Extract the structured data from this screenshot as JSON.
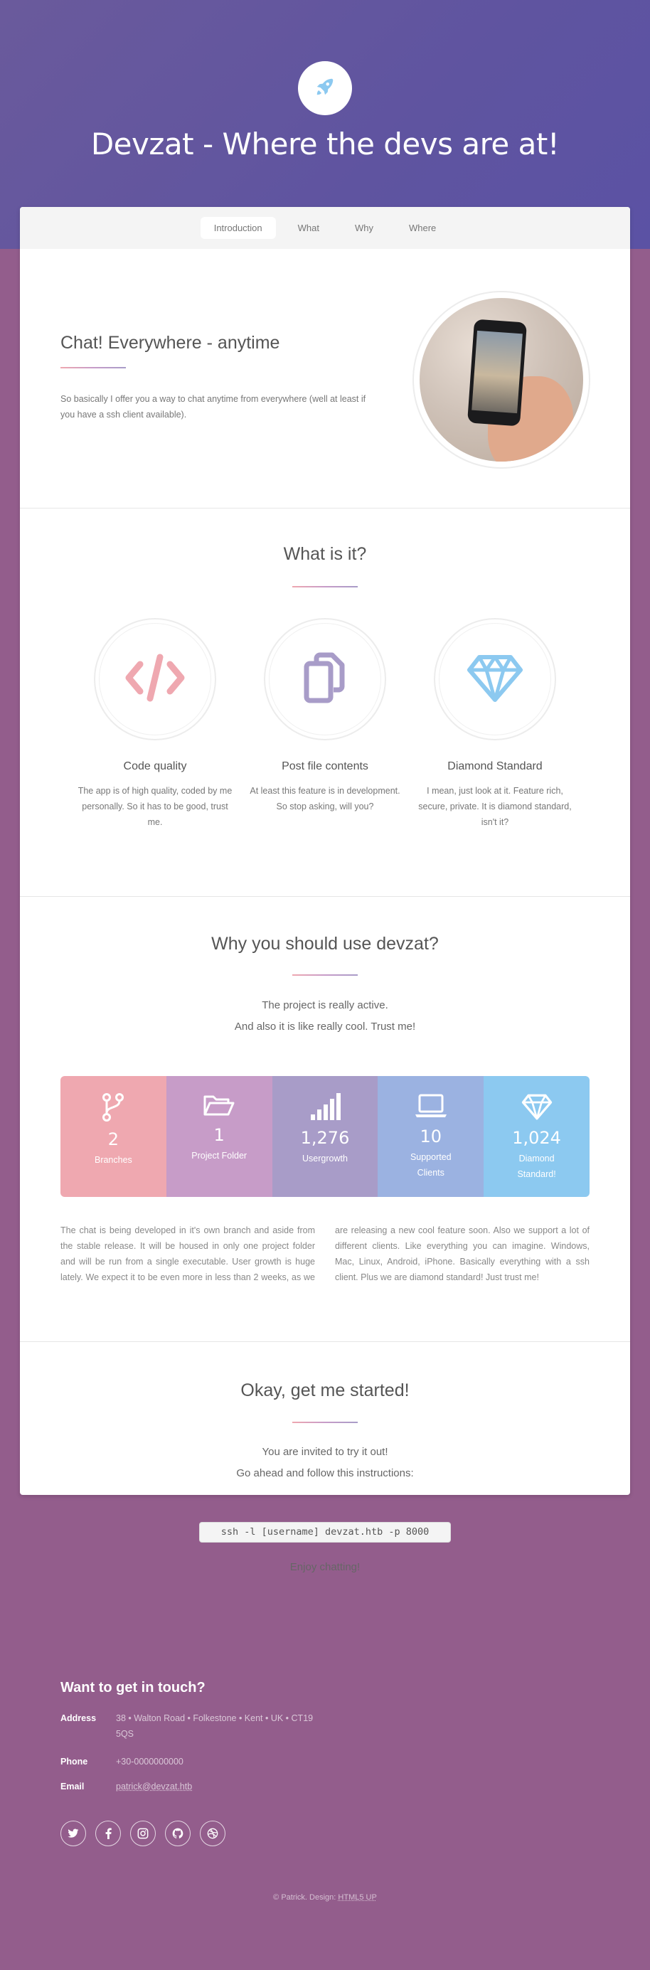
{
  "site": {
    "title": "Devzat - Where the devs are at!",
    "logo_icon": "rocket-icon"
  },
  "nav": {
    "tabs": [
      {
        "label": "Introduction",
        "active": true
      },
      {
        "label": "What",
        "active": false
      },
      {
        "label": "Why",
        "active": false
      },
      {
        "label": "Where",
        "active": false
      }
    ]
  },
  "intro": {
    "title": "Chat! Everywhere - anytime",
    "text": "So basically I offer you a way to chat anytime from everywhere (well at least if you have a ssh client available).",
    "image": "hand-holding-phone-photo"
  },
  "what": {
    "heading": "What is it?",
    "features": [
      {
        "icon": "code-icon",
        "title": "Code quality",
        "text": "The app is of high quality, coded by me personally. So it has to be good, trust me."
      },
      {
        "icon": "copy-icon",
        "title": "Post file contents",
        "text": "At least this feature is in development. So stop asking, will you?"
      },
      {
        "icon": "diamond-icon",
        "title": "Diamond Standard",
        "text": "I mean, just look at it. Feature rich, secure, private. It is diamond standard, isn't it?"
      }
    ]
  },
  "why": {
    "heading": "Why you should use devzat?",
    "line1": "The project is really active.",
    "line2": "And also it is like really cool. Trust me!",
    "stats": [
      {
        "icon": "code-branch-icon",
        "value": "2",
        "label": "Branches",
        "color": "#efa8b0"
      },
      {
        "icon": "folder-open-icon",
        "value": "1",
        "label": "Project Folder",
        "color": "#c79cc8"
      },
      {
        "icon": "signal-icon",
        "value": "1,276",
        "label": "Usergrowth",
        "color": "#a89cc8"
      },
      {
        "icon": "laptop-icon",
        "value": "10",
        "label": "Supported Clients",
        "color": "#9bb2e1"
      },
      {
        "icon": "diamond-icon",
        "value": "1,024",
        "label": "Diamond Standard!",
        "color": "#8cc9f0"
      }
    ],
    "body": "The chat is being developed in it's own branch and aside from the stable release. It will be housed in only one project folder and will be run from a single executable. User growth is huge lately. We expect it to be even more in less than 2 weeks, as we are releasing a new cool feature soon. Also we support a lot of different clients. Like everything you can imagine. Windows, Mac, Linux, Android, iPhone. Basically everything with a ssh client. Plus we are diamond standard! Just trust me!"
  },
  "start": {
    "heading": "Okay, get me started!",
    "line1": "You are invited to try it out!",
    "line2": "Go ahead and follow this instructions:",
    "command": "ssh -l [username] devzat.htb -p 8000",
    "closing": "Enjoy chatting!"
  },
  "footer": {
    "title": "Want to get in touch?",
    "address_label": "Address",
    "address": "38 • Walton Road • Folkestone • Kent • UK • CT19 5QS",
    "phone_label": "Phone",
    "phone": "+30-0000000000",
    "email_label": "Email",
    "email": "patrick@devzat.htb",
    "socials": [
      "twitter-icon",
      "facebook-icon",
      "instagram-icon",
      "github-icon",
      "dribbble-icon"
    ],
    "copyright": "© Patrick. Design:",
    "credit": "HTML5 UP"
  },
  "colors": {
    "header_bg": "#5f54a0",
    "page_bg": "#935d8c",
    "accent_blue": "#8cc9f0",
    "accent_pink": "#efa8b0",
    "accent_purple": "#a89cc8"
  }
}
